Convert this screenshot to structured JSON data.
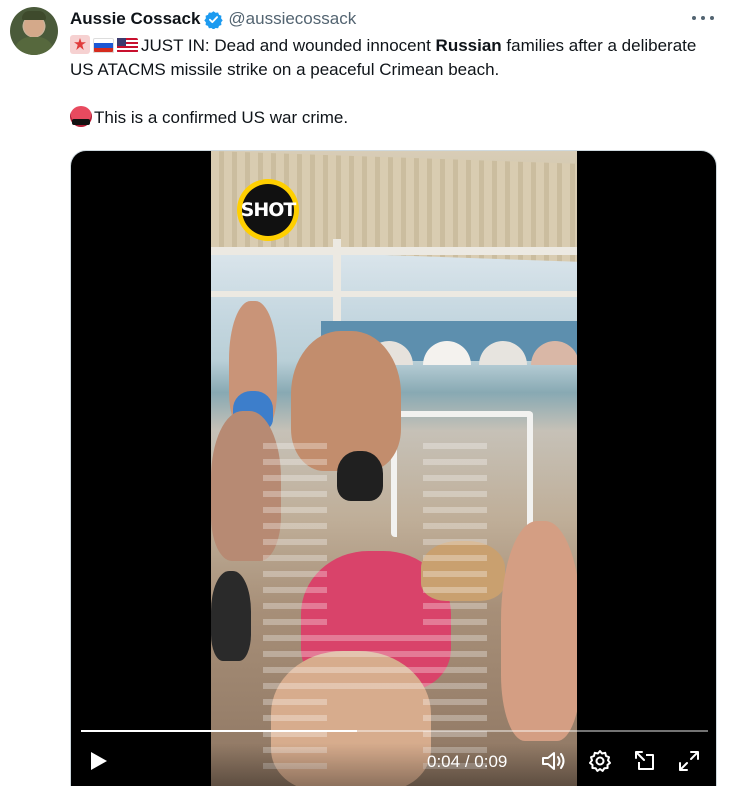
{
  "author": {
    "name": "Aussie Cossack",
    "handle": "@aussiecossack"
  },
  "tweet": {
    "line1_prefix": "JUST IN: Dead and wounded innocent ",
    "line1_bold": "Russian",
    "line1_suffix": " families after a deliberate US ATACMS missile strike on a peaceful Crimean beach.",
    "line2": "This is a confirmed US war crime."
  },
  "video": {
    "logo_text": "SHOT",
    "current_time": "0:04",
    "separator": "/",
    "duration": "0:09",
    "progress_fraction": 0.44
  },
  "icons": {
    "verified": "verified-badge-icon",
    "more": "more-options-icon",
    "play": "play-icon",
    "volume": "volume-icon",
    "settings": "settings-gear-icon",
    "popout": "pop-out-icon",
    "fullscreen": "fullscreen-icon"
  },
  "colors": {
    "verified": "#1d9bf0",
    "handle": "#536471",
    "text": "#0f1419",
    "video_bg": "#000000",
    "logo_ring": "#ffcf00"
  }
}
